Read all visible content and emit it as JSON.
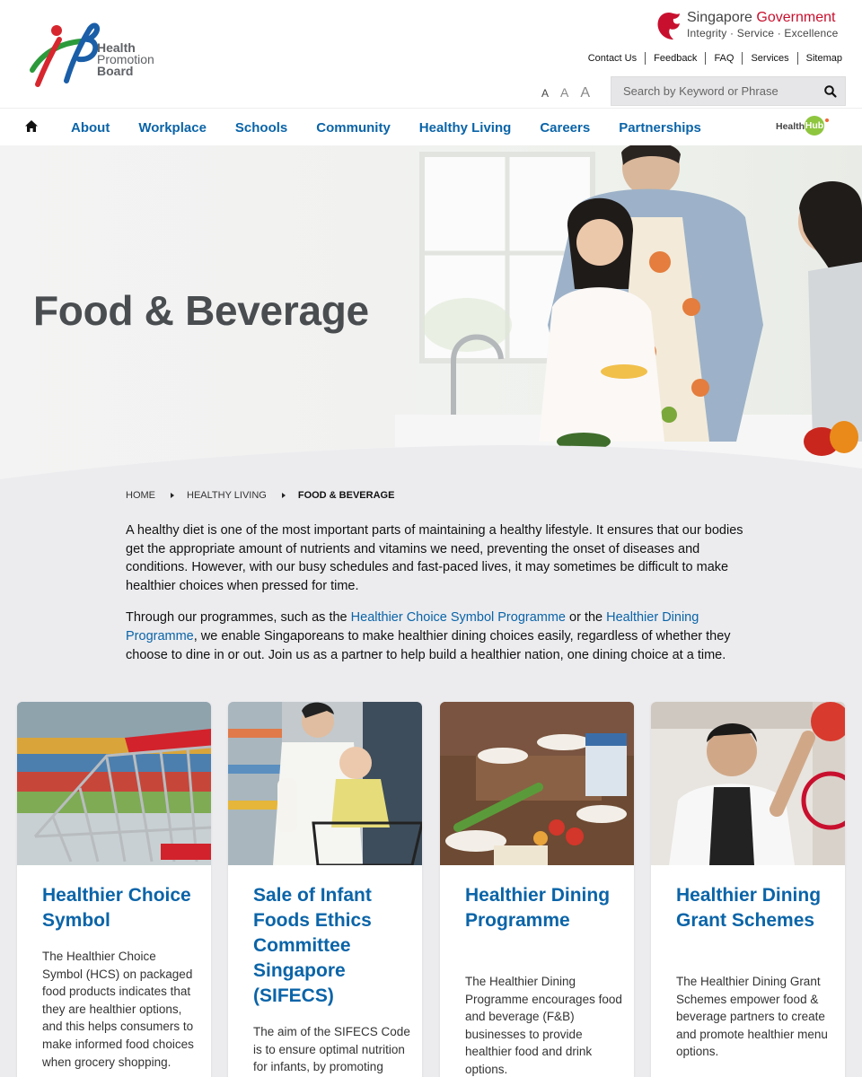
{
  "brand": {
    "logo_lines": [
      "Health",
      "Promotion",
      "Board"
    ],
    "gov_title_1": "Singapore",
    "gov_title_2": "Government",
    "gov_tagline": "Integrity · Service · Excellence"
  },
  "toplinks": [
    "Contact Us",
    "Feedback",
    "FAQ",
    "Services",
    "Sitemap"
  ],
  "font_sizes": [
    "A",
    "A",
    "A"
  ],
  "search": {
    "placeholder": "Search by Keyword or Phrase"
  },
  "nav": {
    "items": [
      "About",
      "Workplace",
      "Schools",
      "Community",
      "Healthy Living",
      "Careers",
      "Partnerships"
    ],
    "healthhub_text": "Health",
    "healthhub_badge": "Hub"
  },
  "hero": {
    "title": "Food & Beverage"
  },
  "breadcrumb": [
    "HOME",
    "HEALTHY LIVING",
    "FOOD & BEVERAGE"
  ],
  "intro": {
    "p1": "A healthy diet is one of the most important parts of maintaining a healthy lifestyle. It ensures that our bodies get the appropriate amount of nutrients and vitamins we need, preventing the onset of diseases and conditions. However, with our busy schedules and fast-paced lives, it may sometimes be difficult to make healthier choices when pressed for time.",
    "p2_before": "Through our programmes, such as the ",
    "p2_link1": "Healthier Choice Symbol Programme",
    "p2_middle": " or the ",
    "p2_link2": "Healthier Dining Programme",
    "p2_after": ", we enable Singaporeans to make healthier dining choices easily, regardless of whether they choose to dine in or out. Join us as a partner to help build a healthier nation, one dining choice at a time."
  },
  "cards": [
    {
      "title": "Healthier Choice Symbol",
      "text": "The Healthier Choice Symbol (HCS) on packaged food products indicates that they are healthier options, and this helps consumers to make informed food choices when grocery shopping."
    },
    {
      "title": "Sale of Infant Foods Ethics Committee Singapore (SIFECS)",
      "text": "The aim of the SIFECS Code is to ensure optimal nutrition for infants, by promoting breastfeeding."
    },
    {
      "title": "Healthier Dining Programme",
      "text": "The Healthier Dining Programme encourages food and beverage (F&B) businesses to provide healthier food and drink options."
    },
    {
      "title": "Healthier Dining Grant Schemes",
      "text": "The Healthier Dining Grant Schemes empower food & beverage partners to create and promote healthier menu options."
    }
  ],
  "colors": {
    "link_blue": "#0a64a8",
    "gov_red": "#c8102e",
    "hub_green": "#8ec63f"
  }
}
